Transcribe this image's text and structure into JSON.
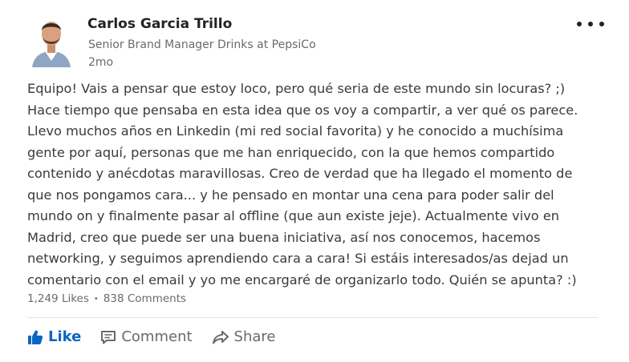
{
  "author": {
    "name": "Carlos Garcia Trillo",
    "headline": "Senior Brand Manager Drinks at PepsiCo",
    "post_age": "2mo"
  },
  "post": {
    "lines": [
      "Equipo! Vais a pensar que estoy loco, pero qué seria de este mundo sin locuras? ;)",
      "Hace tiempo que pensaba en esta idea que os voy a compartir, a ver qué os parece.",
      "Llevo muchos años en Linkedin (mi red social favorita) y he conocido a muchísima",
      "gente por aquí, personas que me han enriquecido, con la que hemos compartido",
      "contenido y anécdotas maravillosas. Creo de verdad que ha llegado el momento de",
      "que nos pongamos cara... y he pensado en montar una cena para poder salir del",
      "mundo on y finalmente pasar al offline (que aun existe jeje). Actualmente vivo en",
      "Madrid, creo que puede ser una buena iniciativa, así nos conocemos, hacemos",
      "networking, y seguimos aprendiendo cara a cara! Si estáis interesados/as dejad un",
      "comentario con el email y yo me encargaré de organizarlo todo. Quién se apunta? :)"
    ]
  },
  "social": {
    "likes": "1,249 Likes",
    "separator": "•",
    "comments": "838 Comments"
  },
  "actions": {
    "like": "Like",
    "comment": "Comment",
    "share": "Share"
  },
  "icons": {
    "like": "thumbs-up-icon",
    "comment": "comment-icon",
    "share": "share-arrow-icon",
    "more": "more-horizontal-icon"
  },
  "colors": {
    "accent": "#0a66c2",
    "text": "#3a3a3a",
    "muted": "#6b6b6b"
  }
}
